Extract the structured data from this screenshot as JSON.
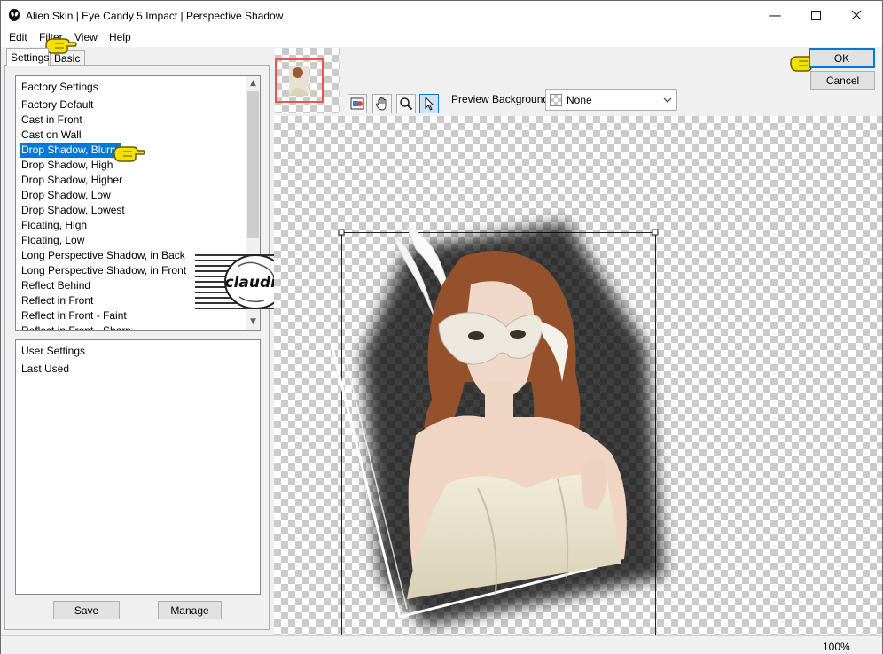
{
  "window": {
    "title": "Alien Skin | Eye Candy 5 Impact | Perspective Shadow"
  },
  "menu": [
    "Edit",
    "Filter",
    "View",
    "Help"
  ],
  "tabs": [
    {
      "label": "Settings",
      "active": true
    },
    {
      "label": "Basic",
      "active": false
    }
  ],
  "factory_settings": {
    "header": "Factory Settings",
    "items": [
      {
        "label": "Factory Default"
      },
      {
        "label": "Cast in Front"
      },
      {
        "label": "Cast on Wall"
      },
      {
        "label": "Drop Shadow, Blurry",
        "selected": true
      },
      {
        "label": "Drop Shadow, High"
      },
      {
        "label": "Drop Shadow, Higher"
      },
      {
        "label": "Drop Shadow, Low"
      },
      {
        "label": "Drop Shadow, Lowest"
      },
      {
        "label": "Floating, High"
      },
      {
        "label": "Floating, Low"
      },
      {
        "label": "Long Perspective Shadow, in Back"
      },
      {
        "label": "Long Perspective Shadow, in Front"
      },
      {
        "label": "Reflect Behind"
      },
      {
        "label": "Reflect in Front"
      },
      {
        "label": "Reflect in Front - Faint"
      },
      {
        "label": "Reflect in Front - Sharp"
      }
    ]
  },
  "user_settings": {
    "header": "User Settings",
    "items": [
      {
        "label": "Last Used"
      }
    ]
  },
  "buttons": {
    "save": "Save",
    "manage": "Manage",
    "ok": "OK",
    "cancel": "Cancel"
  },
  "preview": {
    "background_label": "Preview Background:",
    "background_value": "None"
  },
  "watermark": {
    "text": "claudia"
  },
  "status": {
    "zoom": "100%"
  },
  "colors": {
    "selection": "#0078d7",
    "pointer_yellow": "#f5e100",
    "thumbnail_frame": "#e8574f"
  },
  "icons": [
    "app-logo-icon",
    "minimize-icon",
    "maximize-icon",
    "close-icon",
    "scroll-up-icon",
    "scroll-down-icon",
    "navigator-icon",
    "hand-icon",
    "zoom-icon",
    "arrow-select-icon",
    "dropdown-arrow-icon",
    "hand-pointer-icon"
  ]
}
